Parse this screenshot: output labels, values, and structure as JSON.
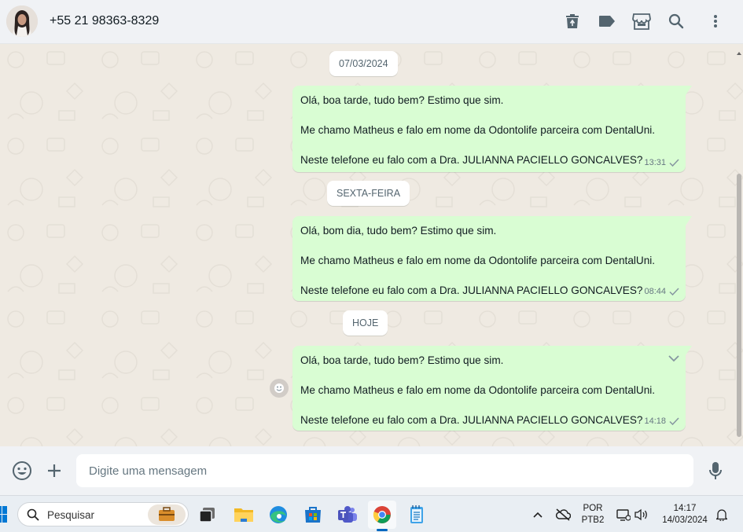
{
  "header": {
    "contact_name": "+55 21 98363-8329",
    "icons": [
      "delete-icon",
      "label-icon",
      "store-icon",
      "search-icon",
      "menu-icon"
    ]
  },
  "chat": {
    "groups": [
      {
        "date": "07/03/2024",
        "lines": [
          "Olá, boa tarde, tudo bem? Estimo que sim.",
          "Me chamo Matheus e falo em nome da Odontolife parceira com DentalUni.",
          "Neste telefone eu falo com a Dra. JULIANNA PACIELLO GONCALVES?"
        ],
        "time": "13:31"
      },
      {
        "date": "SEXTA-FEIRA",
        "lines": [
          "Olá, bom dia, tudo bem? Estimo que sim.",
          "Me chamo Matheus e falo em nome da Odontolife parceira com DentalUni.",
          "Neste telefone eu falo com a Dra. JULIANNA PACIELLO GONCALVES?"
        ],
        "time": "08:44"
      },
      {
        "date": "HOJE",
        "lines": [
          "Olá, boa tarde, tudo bem? Estimo que sim.",
          "Me chamo Matheus e falo em nome da Odontolife parceira com DentalUni.",
          "Neste telefone eu falo com a Dra. JULIANNA PACIELLO GONCALVES?"
        ],
        "time": "14:18"
      }
    ]
  },
  "composer": {
    "placeholder": "Digite uma mensagem"
  },
  "taskbar": {
    "search_label": "Pesquisar",
    "lang_line1": "POR",
    "lang_line2": "PTB2",
    "time": "14:17",
    "date": "14/03/2024"
  },
  "colors": {
    "bubble": "#d9fdd3",
    "chat_bg": "#efeae2",
    "header_bg": "#f0f2f5",
    "icon": "#54656f",
    "accent_blue": "#0067c0"
  }
}
